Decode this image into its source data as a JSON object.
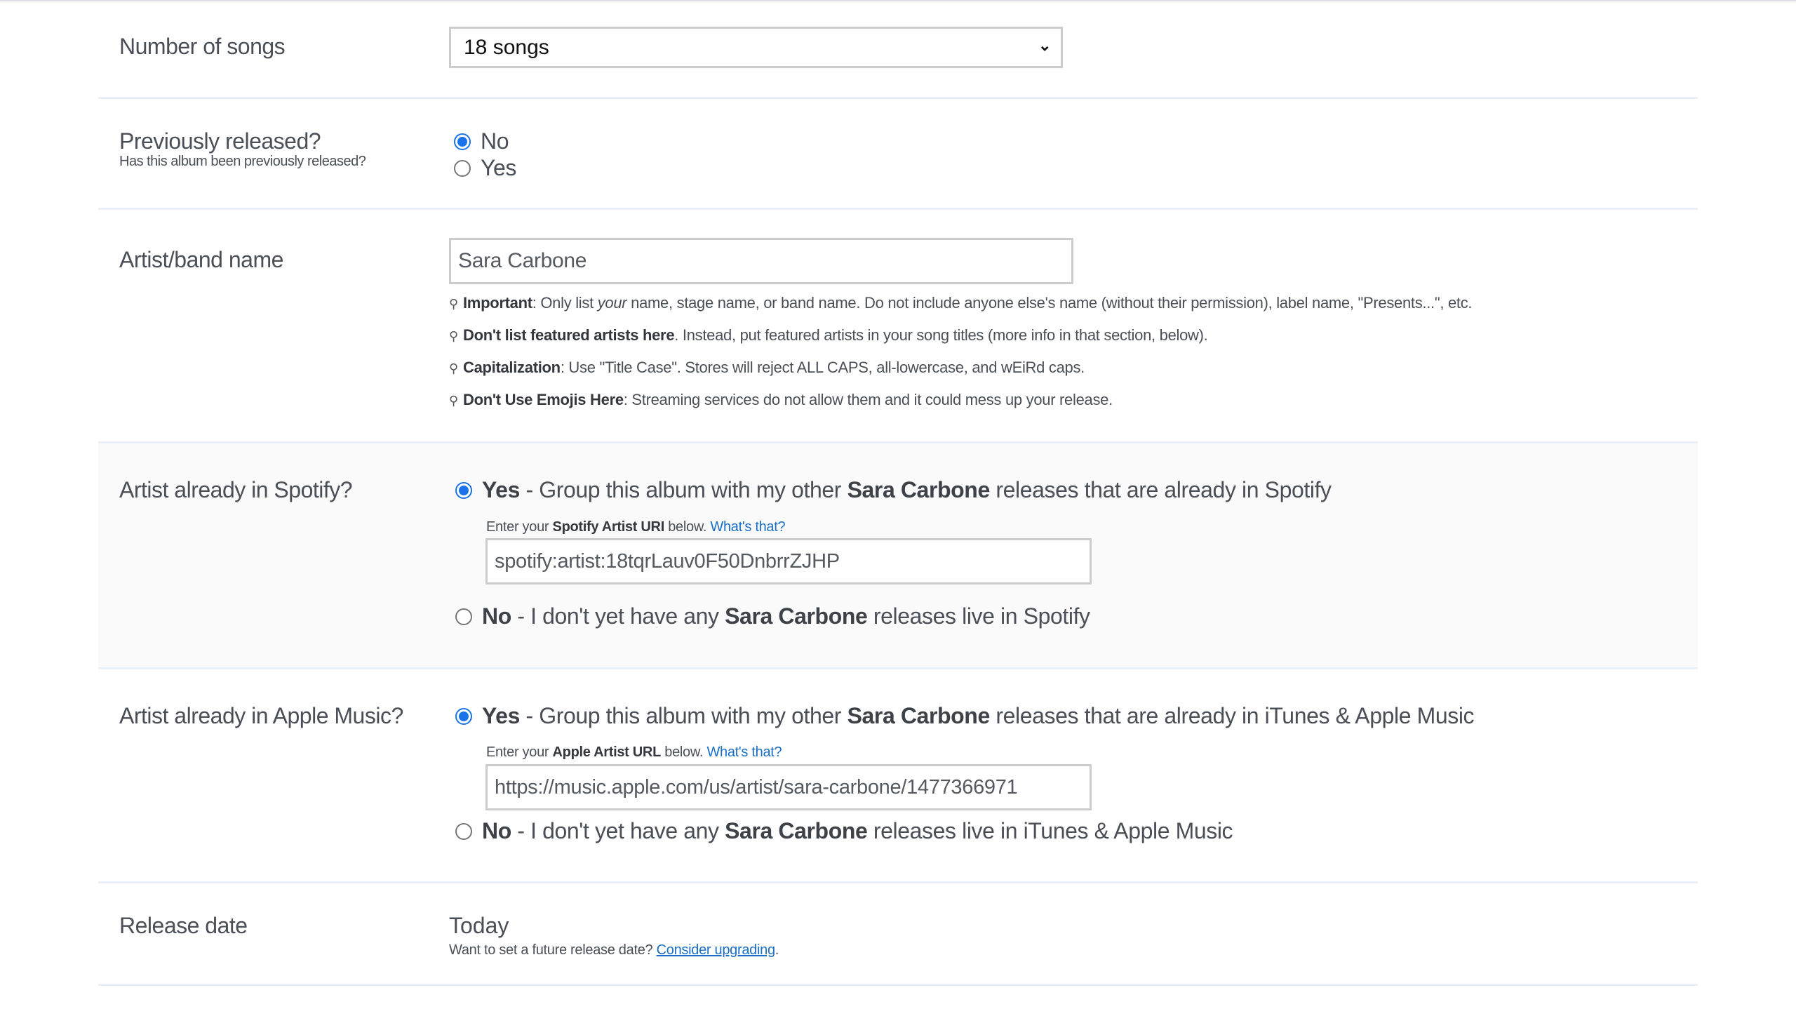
{
  "colors": {
    "accent": "#1a73e8",
    "link": "#1a6fc4",
    "divider": "#e8f1fa",
    "shaded_bg": "#fafafa",
    "input_border": "#cccccc"
  },
  "number_of_songs": {
    "label": "Number of songs",
    "selected": "18 songs"
  },
  "previously_released": {
    "label": "Previously released?",
    "sublabel": "Has this album been previously released?",
    "options": [
      {
        "label": "No",
        "checked": true
      },
      {
        "label": "Yes",
        "checked": false
      }
    ]
  },
  "artist_name": {
    "label": "Artist/band name",
    "value": "Sara Carbone",
    "tips": [
      {
        "bold": "Important",
        "pre": ": Only list ",
        "italic": "your",
        "post": " name, stage name, or band name. Do not include anyone else's name (without their permission), label name, \"Presents...\", etc."
      },
      {
        "bold": "Don't list featured artists here",
        "post": ". Instead, put featured artists in your song titles (more info in that section, below)."
      },
      {
        "bold": "Capitalization",
        "post": ": Use \"Title Case\". Stores will reject ALL CAPS, all-lowercase, and wEiRd caps."
      },
      {
        "bold": "Don't Use Emojis Here",
        "post": ": Streaming services do not allow them and it could mess up your release."
      }
    ]
  },
  "spotify": {
    "label": "Artist already in Spotify?",
    "yes": {
      "bold": "Yes",
      "text1": " - Group this album with my other ",
      "artist": "Sara Carbone",
      "text2": " releases that are already in Spotify",
      "checked": true
    },
    "hint": {
      "pre": "Enter your ",
      "bold": "Spotify Artist URI",
      "post": " below. ",
      "link": "What's that?"
    },
    "value": "spotify:artist:18tqrLauv0F50DnbrrZJHP",
    "no": {
      "bold": "No",
      "text1": " - I don't yet have any ",
      "artist": "Sara Carbone",
      "text2": " releases live in Spotify",
      "checked": false
    }
  },
  "apple": {
    "label": "Artist already in Apple Music?",
    "yes": {
      "bold": "Yes",
      "text1": " - Group this album with my other ",
      "artist": "Sara Carbone",
      "text2": " releases that are already in iTunes & Apple Music",
      "checked": true
    },
    "hint": {
      "pre": "Enter your ",
      "bold": "Apple Artist URL",
      "post": " below. ",
      "link": "What's that?"
    },
    "value": "https://music.apple.com/us/artist/sara-carbone/1477366971",
    "no": {
      "bold": "No",
      "text1": " - I don't yet have any ",
      "artist": "Sara Carbone",
      "text2": " releases live in iTunes & Apple Music",
      "checked": false
    }
  },
  "release_date": {
    "label": "Release date",
    "value": "Today",
    "note": "Want to set a future release date? ",
    "link": "Consider upgrading",
    "suffix": "."
  }
}
